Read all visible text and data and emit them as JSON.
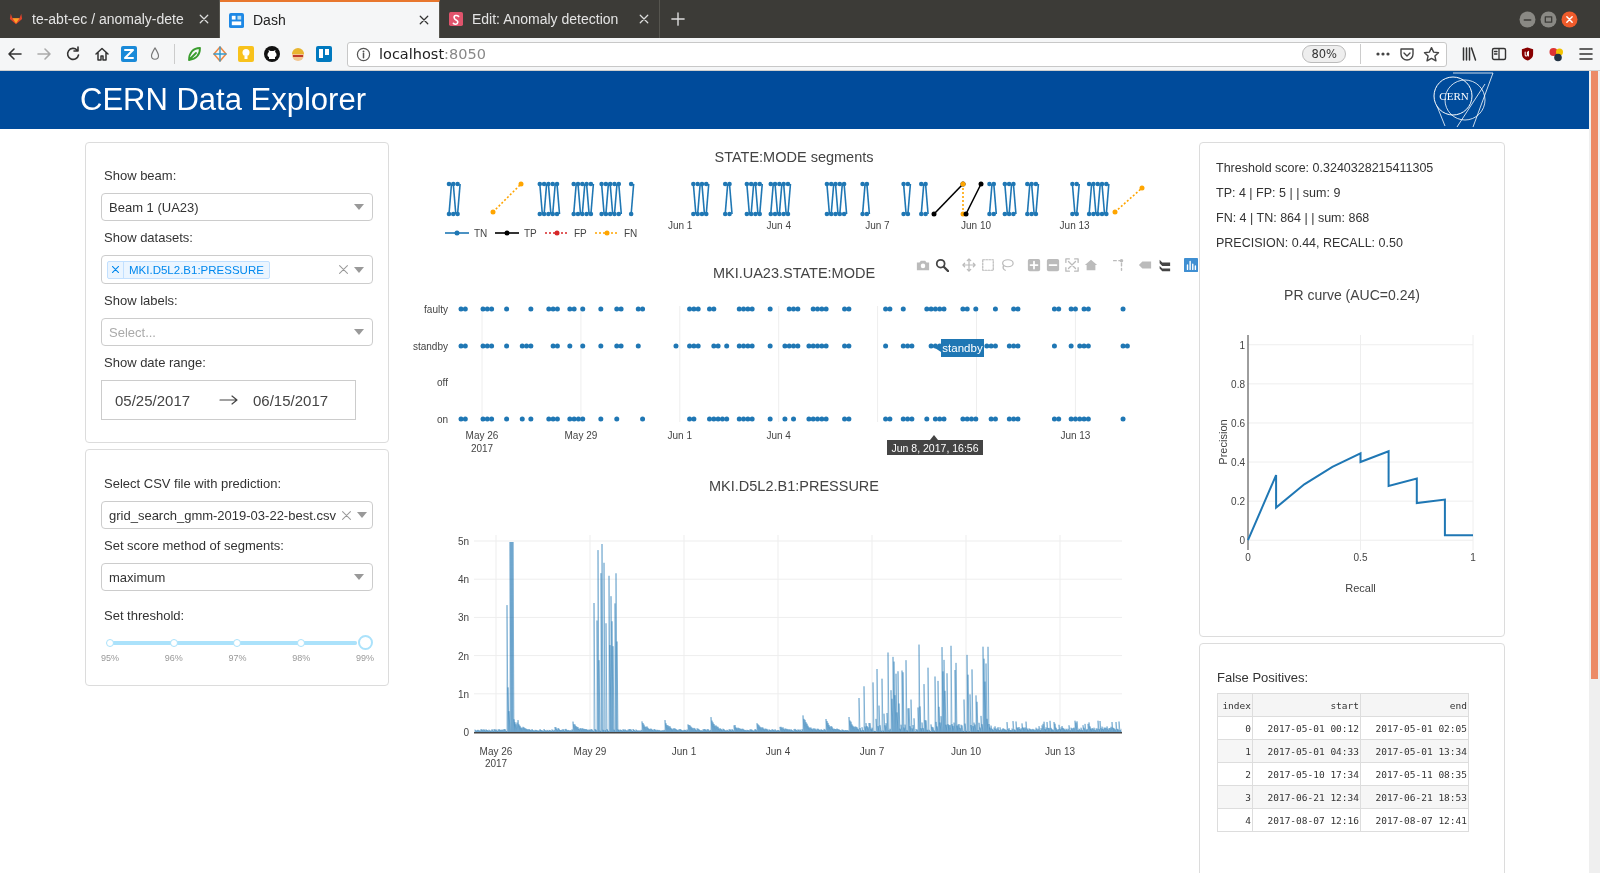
{
  "browser": {
    "tabs": [
      {
        "title": "te-abt-ec / anomaly-dete",
        "selected": false
      },
      {
        "title": "Dash",
        "selected": true
      },
      {
        "title": "Edit: Anomaly detection",
        "selected": false
      }
    ],
    "url": {
      "host": "localhost",
      "port": ":8050"
    },
    "zoom": "80%"
  },
  "header": {
    "title": "CERN Data Explorer",
    "logo_text": "CERN"
  },
  "filters": {
    "beam": {
      "label": "Show beam:",
      "value": "Beam 1 (UA23)"
    },
    "datasets": {
      "label": "Show datasets:",
      "tags": [
        "MKI.D5L2.B1:PRESSURE"
      ]
    },
    "labels": {
      "label": "Show labels:",
      "placeholder": "Select..."
    },
    "date_range": {
      "label": "Show date range:",
      "start": "05/25/2017",
      "end": "06/15/2017"
    }
  },
  "prediction": {
    "csv": {
      "label": "Select CSV file with prediction:",
      "value": "grid_search_gmm-2019-03-22-best.csv"
    },
    "score_method": {
      "label": "Set score method of segments:",
      "value": "maximum"
    },
    "threshold": {
      "label": "Set threshold:",
      "marks": [
        "95%",
        "96%",
        "97%",
        "98%",
        "99%"
      ],
      "level": 1
    }
  },
  "segments_chart": {
    "title": "STATE:MODE segments",
    "x_ticks": [
      "Jun 1",
      "Jun 4",
      "Jun 7",
      "Jun 10",
      "Jun 13"
    ],
    "legend": [
      {
        "label": "TN",
        "color": "#1f77b4",
        "kind": "solid"
      },
      {
        "label": "TP",
        "color": "#000000",
        "kind": "solid"
      },
      {
        "label": "FP",
        "color": "#d62728",
        "kind": "dotted"
      },
      {
        "label": "FN",
        "color": "#ffa500",
        "kind": "dotted"
      }
    ]
  },
  "mode_chart": {
    "title": "MKI.UA23.STATE:MODE",
    "tools": [
      {
        "kind": "camera",
        "selected": false
      },
      {
        "kind": "zoom",
        "selected": true
      },
      {
        "kind": "pan",
        "selected": false
      },
      {
        "kind": "box-select",
        "selected": false
      },
      {
        "kind": "lasso",
        "selected": false
      },
      {
        "kind": "zoom-in",
        "selected": false
      },
      {
        "kind": "zoom-out",
        "selected": false
      },
      {
        "kind": "autoscale",
        "selected": false
      },
      {
        "kind": "reset",
        "selected": false
      },
      {
        "kind": "spikes",
        "selected": false
      },
      {
        "kind": "hover-closest",
        "selected": false
      },
      {
        "kind": "hover-compare",
        "selected": true
      }
    ],
    "y_ticks": [
      "faulty",
      "standby",
      "off",
      "on"
    ],
    "x_ticks": [
      {
        "label": "May 26",
        "sub": "2017"
      },
      {
        "label": "May 29"
      },
      {
        "label": "Jun 1"
      },
      {
        "label": "Jun 4"
      },
      {
        "label": "Jun 13"
      }
    ],
    "hover_label": "standby",
    "hover_time": "Jun 8, 2017, 16:56"
  },
  "pressure_chart": {
    "title": "MKI.D5L2.B1:PRESSURE",
    "y_ticks": [
      "5n",
      "4n",
      "3n",
      "2n",
      "1n",
      "0"
    ],
    "x_ticks": [
      {
        "label": "May 26",
        "sub": "2017"
      },
      {
        "label": "May 29"
      },
      {
        "label": "Jun 1"
      },
      {
        "label": "Jun 4"
      },
      {
        "label": "Jun 7"
      },
      {
        "label": "Jun 10"
      },
      {
        "label": "Jun 13"
      }
    ]
  },
  "results": {
    "stats": [
      "Threshold score: 0.3240328215411305",
      "TP: 4 | FP: 5 | | sum: 9",
      "FN: 4 | TN: 864 | | sum: 868",
      "PRECISION: 0.44, RECALL: 0.50"
    ],
    "pr_chart": {
      "chart_data": {
        "type": "line",
        "title": "PR curve (AUC=0.24)",
        "xlabel": "Recall",
        "ylabel": "Precision",
        "x": [
          0,
          0.125,
          0.125,
          0.25,
          0.375,
          0.5,
          0.5,
          0.625,
          0.625,
          0.75,
          0.75,
          0.875,
          0.875,
          1
        ],
        "series": [
          {
            "color": "#1f77b4",
            "values": [
              0,
              0.333,
              0.167,
              0.286,
              0.375,
              0.444,
              0.4,
              0.455,
              0.278,
              0.316,
              0.19,
              0.208,
              0.025,
              0.025
            ]
          }
        ],
        "xlim": [
          0,
          1
        ],
        "ylim": [
          -0.05,
          1.05
        ],
        "xticks": [
          0,
          0.5,
          1
        ],
        "yticks": [
          0,
          0.2,
          0.4,
          0.6,
          0.8,
          1
        ],
        "grid": true
      }
    }
  },
  "false_positives": {
    "title": "False Positives:",
    "columns": [
      "index",
      "start",
      "end"
    ],
    "rows": [
      [
        "0",
        "2017-05-01 00:12",
        "2017-05-01 02:05"
      ],
      [
        "1",
        "2017-05-01 04:33",
        "2017-05-01 13:34"
      ],
      [
        "2",
        "2017-05-10 17:34",
        "2017-05-11 08:35"
      ],
      [
        "3",
        "2017-06-21 12:34",
        "2017-06-21 18:53"
      ],
      [
        "4",
        "2017-08-07 12:16",
        "2017-08-07 12:41"
      ]
    ]
  }
}
